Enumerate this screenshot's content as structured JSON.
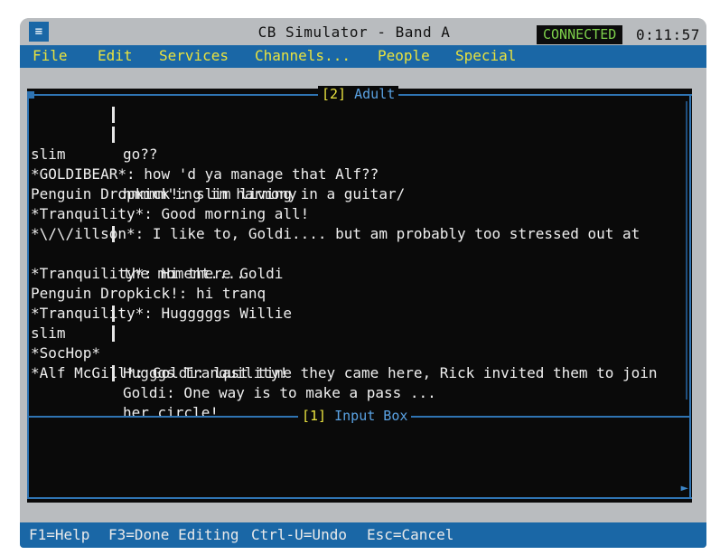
{
  "app": {
    "title": "CB Simulator - Band A",
    "status": "CONNECTED",
    "clock": "0:11:57",
    "system_menu_glyph": "≡"
  },
  "menu": [
    "File",
    "Edit",
    "Services",
    "Channels...",
    "People",
    "Special"
  ],
  "chat_window": {
    "title_number": "[2]",
    "title_name": "Adult",
    "lines": [
      {
        "name": "",
        "sep": true,
        "text": "go??"
      },
      {
        "name": "slim",
        "sep": true,
        "text": "hmmmm'ing in harmony"
      },
      {
        "name": "",
        "sep": false,
        "text": "*GOLDIBEAR*: how 'd ya manage that Alf??"
      },
      {
        "name": "",
        "sep": false,
        "text": "Penguin Dropkick!: slim living in a guitar/"
      },
      {
        "name": "",
        "sep": false,
        "text": "*Tranquility*: Good morning all!"
      },
      {
        "name": "",
        "sep": false,
        "text": "*\\/\\/illson*: I like to, Goldi.... but am probably too stressed out at"
      },
      {
        "name": "",
        "sep": true,
        "text": "the moment...."
      },
      {
        "name": "",
        "sep": false,
        "text": "*Tranquility*: Hi there Goldi"
      },
      {
        "name": "",
        "sep": false,
        "text": "Penguin Dropkick!: hi tranq"
      },
      {
        "name": "",
        "sep": false,
        "text": "*Tranquility*: Hugggggs Willie"
      },
      {
        "name": "slim",
        "sep": true,
        "text": "Hugggs Tranquility!"
      },
      {
        "name": "*SocHop*",
        "sep": true,
        "text": "Goldi: One way is to make a pass ..."
      },
      {
        "name": "",
        "sep": false,
        "text": "*Alf McGill*: Goldi: last time they came here, Rick invited them to join"
      },
      {
        "name": "",
        "sep": true,
        "text": "her circle!"
      }
    ]
  },
  "input_box": {
    "title_number": "[1]",
    "title_name": "Input Box",
    "value": ""
  },
  "function_keys": [
    "F1=Help",
    "F3=Done Editing",
    "Ctrl-U=Undo",
    "Esc=Cancel"
  ],
  "colors": {
    "menu_bar": "#1a67a6",
    "menu_text": "#e9e23f",
    "connected_text": "#7ed14b",
    "window_bg": "#0a0a0a",
    "frame": "#2f74b3"
  }
}
